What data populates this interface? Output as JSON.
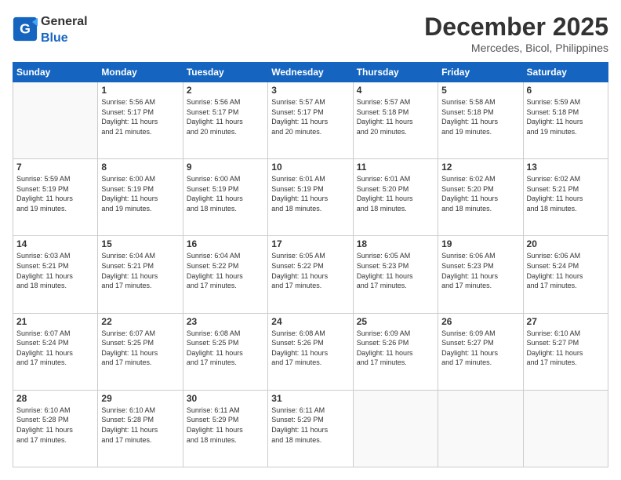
{
  "header": {
    "logo_general": "General",
    "logo_blue": "Blue",
    "month": "December 2025",
    "location": "Mercedes, Bicol, Philippines"
  },
  "days_of_week": [
    "Sunday",
    "Monday",
    "Tuesday",
    "Wednesday",
    "Thursday",
    "Friday",
    "Saturday"
  ],
  "weeks": [
    [
      {
        "day": "",
        "empty": true
      },
      {
        "day": "1",
        "line1": "Sunrise: 5:56 AM",
        "line2": "Sunset: 5:17 PM",
        "line3": "Daylight: 11 hours",
        "line4": "and 21 minutes."
      },
      {
        "day": "2",
        "line1": "Sunrise: 5:56 AM",
        "line2": "Sunset: 5:17 PM",
        "line3": "Daylight: 11 hours",
        "line4": "and 20 minutes."
      },
      {
        "day": "3",
        "line1": "Sunrise: 5:57 AM",
        "line2": "Sunset: 5:17 PM",
        "line3": "Daylight: 11 hours",
        "line4": "and 20 minutes."
      },
      {
        "day": "4",
        "line1": "Sunrise: 5:57 AM",
        "line2": "Sunset: 5:18 PM",
        "line3": "Daylight: 11 hours",
        "line4": "and 20 minutes."
      },
      {
        "day": "5",
        "line1": "Sunrise: 5:58 AM",
        "line2": "Sunset: 5:18 PM",
        "line3": "Daylight: 11 hours",
        "line4": "and 19 minutes."
      },
      {
        "day": "6",
        "line1": "Sunrise: 5:59 AM",
        "line2": "Sunset: 5:18 PM",
        "line3": "Daylight: 11 hours",
        "line4": "and 19 minutes."
      }
    ],
    [
      {
        "day": "7",
        "line1": "Sunrise: 5:59 AM",
        "line2": "Sunset: 5:19 PM",
        "line3": "Daylight: 11 hours",
        "line4": "and 19 minutes."
      },
      {
        "day": "8",
        "line1": "Sunrise: 6:00 AM",
        "line2": "Sunset: 5:19 PM",
        "line3": "Daylight: 11 hours",
        "line4": "and 19 minutes."
      },
      {
        "day": "9",
        "line1": "Sunrise: 6:00 AM",
        "line2": "Sunset: 5:19 PM",
        "line3": "Daylight: 11 hours",
        "line4": "and 18 minutes."
      },
      {
        "day": "10",
        "line1": "Sunrise: 6:01 AM",
        "line2": "Sunset: 5:19 PM",
        "line3": "Daylight: 11 hours",
        "line4": "and 18 minutes."
      },
      {
        "day": "11",
        "line1": "Sunrise: 6:01 AM",
        "line2": "Sunset: 5:20 PM",
        "line3": "Daylight: 11 hours",
        "line4": "and 18 minutes."
      },
      {
        "day": "12",
        "line1": "Sunrise: 6:02 AM",
        "line2": "Sunset: 5:20 PM",
        "line3": "Daylight: 11 hours",
        "line4": "and 18 minutes."
      },
      {
        "day": "13",
        "line1": "Sunrise: 6:02 AM",
        "line2": "Sunset: 5:21 PM",
        "line3": "Daylight: 11 hours",
        "line4": "and 18 minutes."
      }
    ],
    [
      {
        "day": "14",
        "line1": "Sunrise: 6:03 AM",
        "line2": "Sunset: 5:21 PM",
        "line3": "Daylight: 11 hours",
        "line4": "and 18 minutes."
      },
      {
        "day": "15",
        "line1": "Sunrise: 6:04 AM",
        "line2": "Sunset: 5:21 PM",
        "line3": "Daylight: 11 hours",
        "line4": "and 17 minutes."
      },
      {
        "day": "16",
        "line1": "Sunrise: 6:04 AM",
        "line2": "Sunset: 5:22 PM",
        "line3": "Daylight: 11 hours",
        "line4": "and 17 minutes."
      },
      {
        "day": "17",
        "line1": "Sunrise: 6:05 AM",
        "line2": "Sunset: 5:22 PM",
        "line3": "Daylight: 11 hours",
        "line4": "and 17 minutes."
      },
      {
        "day": "18",
        "line1": "Sunrise: 6:05 AM",
        "line2": "Sunset: 5:23 PM",
        "line3": "Daylight: 11 hours",
        "line4": "and 17 minutes."
      },
      {
        "day": "19",
        "line1": "Sunrise: 6:06 AM",
        "line2": "Sunset: 5:23 PM",
        "line3": "Daylight: 11 hours",
        "line4": "and 17 minutes."
      },
      {
        "day": "20",
        "line1": "Sunrise: 6:06 AM",
        "line2": "Sunset: 5:24 PM",
        "line3": "Daylight: 11 hours",
        "line4": "and 17 minutes."
      }
    ],
    [
      {
        "day": "21",
        "line1": "Sunrise: 6:07 AM",
        "line2": "Sunset: 5:24 PM",
        "line3": "Daylight: 11 hours",
        "line4": "and 17 minutes."
      },
      {
        "day": "22",
        "line1": "Sunrise: 6:07 AM",
        "line2": "Sunset: 5:25 PM",
        "line3": "Daylight: 11 hours",
        "line4": "and 17 minutes."
      },
      {
        "day": "23",
        "line1": "Sunrise: 6:08 AM",
        "line2": "Sunset: 5:25 PM",
        "line3": "Daylight: 11 hours",
        "line4": "and 17 minutes."
      },
      {
        "day": "24",
        "line1": "Sunrise: 6:08 AM",
        "line2": "Sunset: 5:26 PM",
        "line3": "Daylight: 11 hours",
        "line4": "and 17 minutes."
      },
      {
        "day": "25",
        "line1": "Sunrise: 6:09 AM",
        "line2": "Sunset: 5:26 PM",
        "line3": "Daylight: 11 hours",
        "line4": "and 17 minutes."
      },
      {
        "day": "26",
        "line1": "Sunrise: 6:09 AM",
        "line2": "Sunset: 5:27 PM",
        "line3": "Daylight: 11 hours",
        "line4": "and 17 minutes."
      },
      {
        "day": "27",
        "line1": "Sunrise: 6:10 AM",
        "line2": "Sunset: 5:27 PM",
        "line3": "Daylight: 11 hours",
        "line4": "and 17 minutes."
      }
    ],
    [
      {
        "day": "28",
        "line1": "Sunrise: 6:10 AM",
        "line2": "Sunset: 5:28 PM",
        "line3": "Daylight: 11 hours",
        "line4": "and 17 minutes."
      },
      {
        "day": "29",
        "line1": "Sunrise: 6:10 AM",
        "line2": "Sunset: 5:28 PM",
        "line3": "Daylight: 11 hours",
        "line4": "and 17 minutes."
      },
      {
        "day": "30",
        "line1": "Sunrise: 6:11 AM",
        "line2": "Sunset: 5:29 PM",
        "line3": "Daylight: 11 hours",
        "line4": "and 18 minutes."
      },
      {
        "day": "31",
        "line1": "Sunrise: 6:11 AM",
        "line2": "Sunset: 5:29 PM",
        "line3": "Daylight: 11 hours",
        "line4": "and 18 minutes."
      },
      {
        "day": "",
        "empty": true
      },
      {
        "day": "",
        "empty": true
      },
      {
        "day": "",
        "empty": true
      }
    ]
  ]
}
